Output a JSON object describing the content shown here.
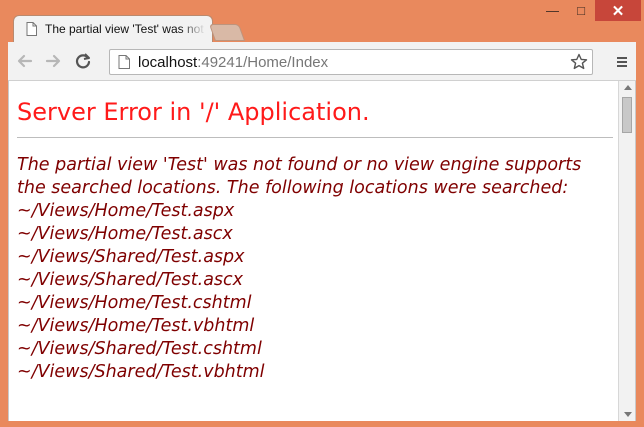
{
  "browser": {
    "tab_title": "The partial view 'Test' was not found or no view engine supports the searched locations.",
    "address": {
      "host": "localhost",
      "path": ":49241/Home/Index"
    },
    "controls": {
      "back": "back-arrow-icon",
      "forward": "forward-arrow-icon",
      "reload": "reload-icon",
      "bookmark": "star-icon",
      "menu": "menu-icon",
      "minimize": "minimize-icon",
      "maximize": "maximize-icon",
      "close": "close-icon",
      "close_label": "✕",
      "minimize_label": "—",
      "maximize_label": "□"
    }
  },
  "page": {
    "title": "Server Error in '/' Application.",
    "message": "The partial view 'Test' was not found or no view engine supports the searched locations. The following locations were searched:",
    "locations": [
      "~/Views/Home/Test.aspx",
      "~/Views/Home/Test.ascx",
      "~/Views/Shared/Test.aspx",
      "~/Views/Shared/Test.ascx",
      "~/Views/Home/Test.cshtml",
      "~/Views/Home/Test.vbhtml",
      "~/Views/Shared/Test.cshtml",
      "~/Views/Shared/Test.vbhtml"
    ]
  },
  "colors": {
    "frame": "#e9895d",
    "error_title": "#ff1a1a",
    "message": "#7f0000",
    "close_button": "#c7463a"
  }
}
